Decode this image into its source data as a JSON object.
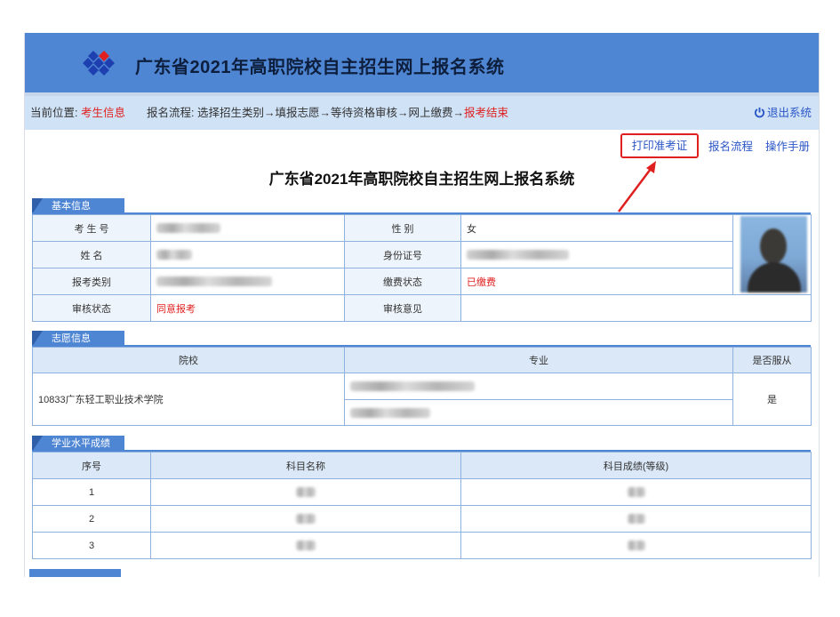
{
  "header": {
    "title": "广东省2021年高职院校自主招生网上报名系统"
  },
  "breadcrumb": {
    "location_label": "当前位置:",
    "location_value": "考生信息",
    "flow_label": "报名流程:",
    "steps": [
      "选择招生类别",
      "填报志愿",
      "等待资格审核",
      "网上缴费",
      "报考结束"
    ],
    "arrow": "→",
    "logout": "退出系统",
    "logout_icon": "power-icon"
  },
  "links": {
    "print": "打印准考证",
    "flow": "报名流程",
    "manual": "操作手册"
  },
  "page_title": "广东省2021年高职院校自主招生网上报名系统",
  "basic_info": {
    "section_title": "基本信息",
    "labels": {
      "exam_no": "考 生 号",
      "name": "姓    名",
      "category": "报考类别",
      "review_status": "审核状态",
      "gender": "性    别",
      "id_no": "身份证号",
      "payment_status": "缴费状态",
      "review_opinion": "审核意见"
    },
    "values": {
      "gender": "女",
      "payment_status": "已缴费",
      "review_status": "同意报考",
      "review_opinion": ""
    }
  },
  "wish_info": {
    "section_title": "志愿信息",
    "columns": [
      "院校",
      "专业",
      "是否服从"
    ],
    "school": "10833广东轻工职业技术学院",
    "obey": "是"
  },
  "scores": {
    "section_title": "学业水平成绩",
    "columns": [
      "序号",
      "科目名称",
      "科目成绩(等级)"
    ],
    "rows": [
      "1",
      "2",
      "3"
    ]
  },
  "colors": {
    "brand": "#4f86d4",
    "accent_red": "#e02020",
    "link": "#2a56c6"
  }
}
